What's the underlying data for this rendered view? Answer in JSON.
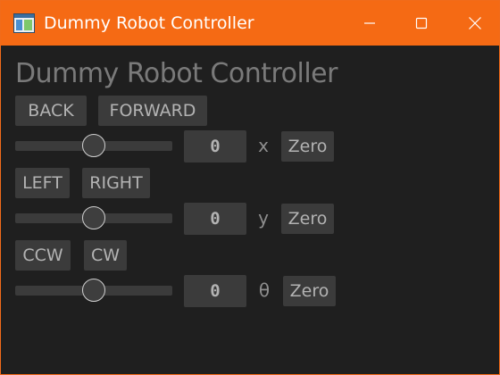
{
  "window": {
    "title": "Dummy Robot Controller",
    "titlebar_color": "#f56a14",
    "background_color": "#1f1f1f"
  },
  "main": {
    "heading": "Dummy Robot Controller",
    "rows": [
      {
        "buttons": [
          "BACK",
          "FORWARD"
        ],
        "slider_fraction": 0.5,
        "value": "0",
        "axis": "x",
        "zero_label": "Zero"
      },
      {
        "buttons": [
          "LEFT",
          "RIGHT"
        ],
        "slider_fraction": 0.5,
        "value": "0",
        "axis": "y",
        "zero_label": "Zero"
      },
      {
        "buttons": [
          "CCW",
          "CW"
        ],
        "slider_fraction": 0.5,
        "value": "0",
        "axis": "θ",
        "zero_label": "Zero"
      }
    ]
  },
  "icons": {
    "app": "app-window-icon",
    "minimize": "minimize-icon",
    "maximize": "maximize-icon",
    "close": "close-icon"
  }
}
